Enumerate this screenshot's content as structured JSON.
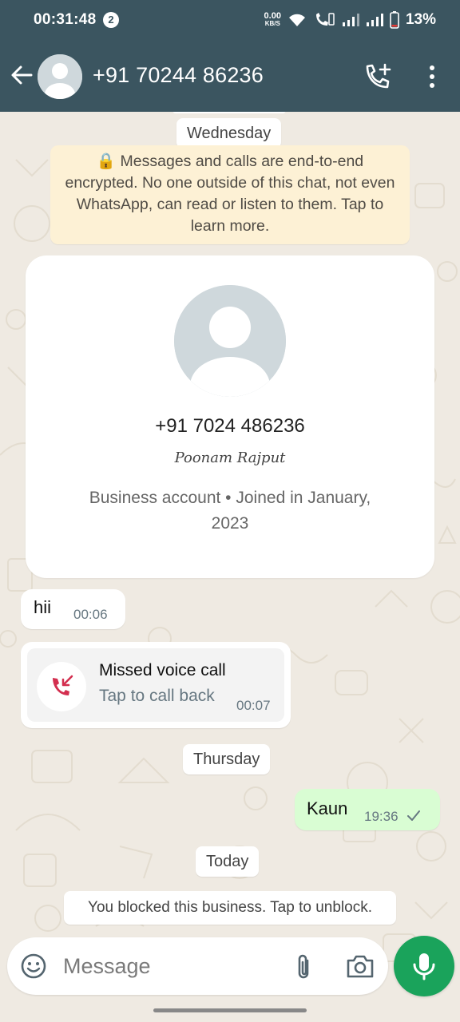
{
  "status_bar": {
    "time": "00:31:48",
    "notification_count": "2",
    "net_speed": "0.00",
    "net_unit": "KB/S",
    "battery": "13%"
  },
  "header": {
    "contact_name": "+91 70244 86236"
  },
  "chat": {
    "date_wednesday": "Wednesday",
    "encryption_notice": "🔒 Messages and calls are end-to-end encrypted. No one outside of this chat, not even WhatsApp, can read or listen to them. Tap to learn more.",
    "profile": {
      "phone": "+91 7024 486236",
      "name": "Poonam Rajput",
      "info": "Business account • Joined in January, 2023"
    },
    "messages": [
      {
        "text": "hii",
        "time": "00:06"
      }
    ],
    "missed_call": {
      "title": "Missed voice call",
      "subtitle": "Tap to call back",
      "time": "00:07"
    },
    "date_thursday": "Thursday",
    "outgoing": {
      "text": "Kaun",
      "time": "19:36"
    },
    "date_today": "Today",
    "blocked_notice": "You blocked this business. Tap to unblock."
  },
  "input": {
    "placeholder": "Message"
  },
  "colors": {
    "header_bg": "#3b5560",
    "chat_bg": "#efeae2",
    "outgoing_bubble": "#d9fdd3",
    "mic_button": "#1aa35b",
    "missed_call_red": "#d32f4f"
  }
}
